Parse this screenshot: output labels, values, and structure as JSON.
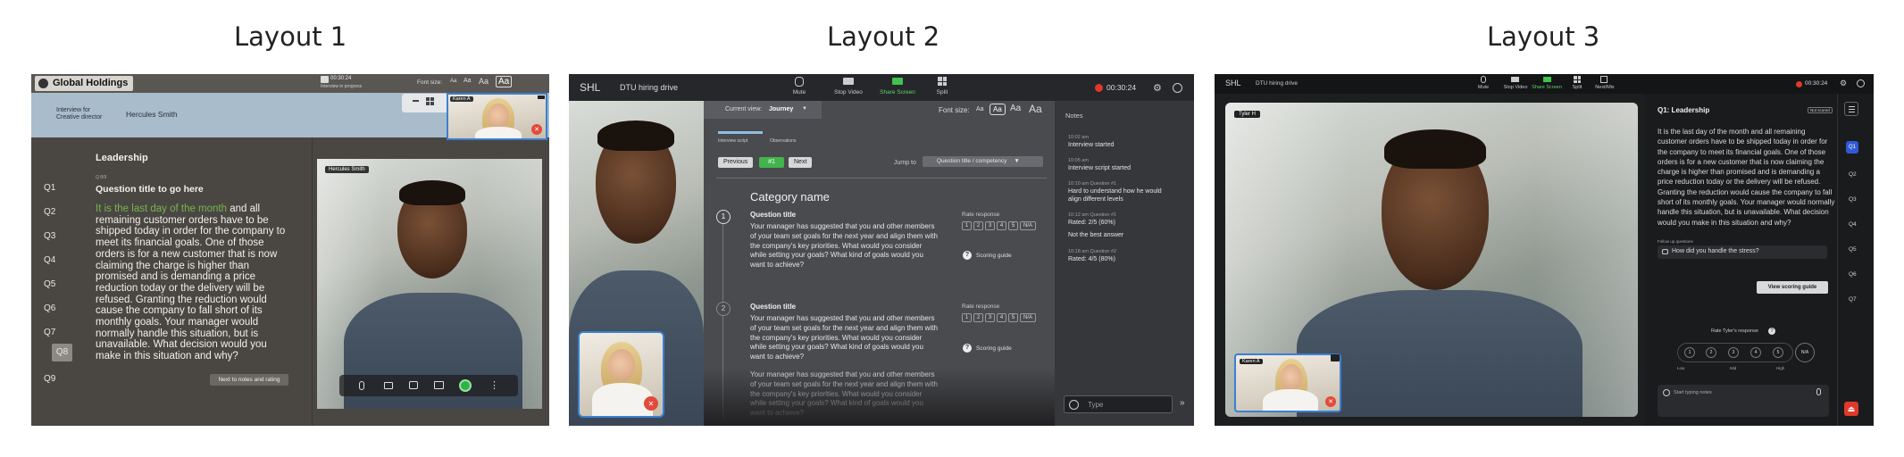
{
  "titles": [
    "Layout 1",
    "Layout 2",
    "Layout 3"
  ],
  "layout1": {
    "logo": "Global Holdings",
    "timer": "00:30:24",
    "timer_sub": "Interview in progress",
    "font_size_label": "Font size:",
    "font_opts": [
      "Aa",
      "Aa",
      "Aa",
      "Aa"
    ],
    "role": "Interview for\nCreative director",
    "candidate": "Hercules Smith",
    "thumb_name": "Karen A",
    "section": "Leadership",
    "q_small": "Q 8/9",
    "question_title": "Question title to go here",
    "question_highlight": "It is the last day of the month",
    "question_rest": " and all remaining customer orders have to be shipped today in order for the company to meet its financial goals. One of those orders is for a new customer that is now claiming the charge is higher than promised and is demanding a price reduction today or the delivery will be refused. Granting the reduction would cause the company to fall short of its monthly goals. Your manager would normally handle this situation, but is unavailable. What decision would you make in this situation and why?",
    "questions": [
      "Q1",
      "Q2",
      "Q3",
      "Q4",
      "Q5",
      "Q6",
      "Q7",
      "Q8",
      "Q9"
    ],
    "selected_q": "Q8",
    "next_button": "Next to notes and rating",
    "video_name": "Hercules Smith"
  },
  "layout2": {
    "logo": "SHL",
    "drive": "DTU hiring drive",
    "toolbar": [
      "Mute",
      "Stop Video",
      "Share Screen",
      "Split"
    ],
    "timer": "00:30:24",
    "current_view_label": "Current view:",
    "current_view": "Journey",
    "font_size_label": "Font size:",
    "font_opts": [
      "Aa",
      "Aa",
      "Aa",
      "Aa"
    ],
    "steps": [
      "Interview script",
      "Observations"
    ],
    "prev": "Previous",
    "num": "#1",
    "next": "Next",
    "jump_label": "Jump to",
    "jump_value": "Question title / competency",
    "category": "Category name",
    "q1_num": "1",
    "q2_num": "2",
    "q_title": "Question title",
    "q_text": "Your manager has suggested that you and other members of your team set goals for the next year and align them with the company's key priorities. What would you consider while setting your goals? What kind of goals would you want to achieve?",
    "rate_label": "Rate response",
    "rate_opts": [
      "1",
      "2",
      "3",
      "4",
      "5",
      "N/A"
    ],
    "scoring": "Scoring guide",
    "notes_title": "Notes",
    "notes": [
      {
        "t": "10:02 am",
        "b": "Interview started"
      },
      {
        "t": "10:05 am",
        "b": "Interview script started"
      },
      {
        "t": "10:10 am Question #1",
        "b": "Hard to understand how he would align different levels"
      },
      {
        "t": "10:12 am Question #1",
        "b": "Rated: 2/5 (60%)"
      },
      {
        "t": "",
        "b": "Not the best answer"
      },
      {
        "t": "10:18 am Question #2",
        "b": "Rated: 4/5 (80%)"
      }
    ],
    "type_placeholder": "Type"
  },
  "layout3": {
    "logo": "SHL",
    "drive": "DTU hiring drive",
    "toolbar": [
      "Mute",
      "Stop Video",
      "Share Screen",
      "Split",
      "Next/Mix"
    ],
    "timer": "00:30:24",
    "video_name": "Tyler H",
    "thumb_name": "Karen A",
    "q_heading": "Q1: Leadership",
    "q_badge": "Not scored",
    "q_text": "It is the last day of the month and all remaining customer orders have to be shipped today in order for the company to meet its financial goals. One of those orders is for a new customer that is now claiming the charge is higher than promised and is demanding a price reduction today or the delivery will be refused. Granting the reduction would cause the company to fall short of its monthly goals. Your manager would normally handle this situation, but is unavailable. What decision would you make in this situation and why?",
    "followup_label": "Follow up questions",
    "followup": "How did you handle the stress?",
    "scoring_btn": "View scoring guide",
    "rate_label": "Rate Tyler's response",
    "rate_opts": [
      "1",
      "2",
      "3",
      "4",
      "5",
      "N/A"
    ],
    "scale": [
      "Low",
      "Mid",
      "High"
    ],
    "notes_placeholder": "Start typing notes",
    "qnav": [
      "Q1",
      "Q2",
      "Q3",
      "Q4",
      "Q5",
      "Q6",
      "Q7"
    ]
  }
}
